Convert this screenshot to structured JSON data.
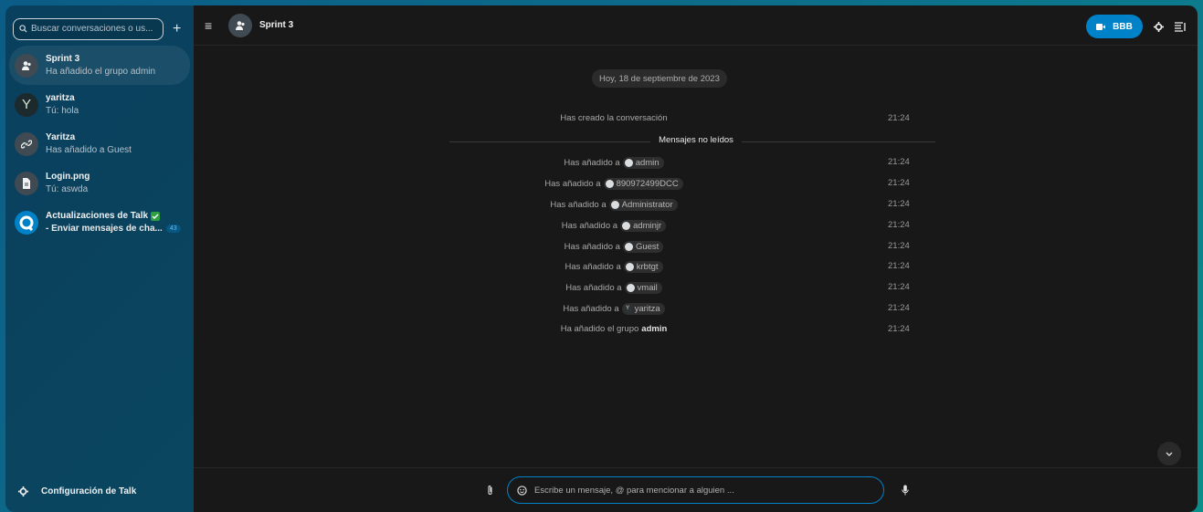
{
  "sidebar": {
    "search_placeholder": "Buscar conversaciones o us...",
    "plus": "+",
    "conversations": [
      {
        "name": "Sprint 3",
        "sub": "Ha añadido el grupo admin"
      },
      {
        "name": "yaritza",
        "sub": "Tú: hola",
        "avatar_letter": "Y"
      },
      {
        "name": "Yaritza",
        "sub": "Has añadido a Guest"
      },
      {
        "name": "Login.png",
        "sub": "Tú: aswda"
      },
      {
        "name": "Actualizaciones de Talk",
        "sub": "- Enviar mensajes de cha...",
        "badge": "43"
      }
    ],
    "settings_label": "Configuración de Talk"
  },
  "header": {
    "menu": "≡",
    "title": "Sprint 3",
    "call_label": "BBB"
  },
  "chat": {
    "date": "Hoy, 18 de septiembre de 2023",
    "created": {
      "text": "Has creado la conversación",
      "time": "21:24"
    },
    "unread_label": "Mensajes no leídos",
    "added_prefix": "Has añadido a",
    "added": [
      {
        "user": "admin",
        "time": "21:24"
      },
      {
        "user": "890972499DCC",
        "time": "21:24"
      },
      {
        "user": "Administrator",
        "time": "21:24"
      },
      {
        "user": "adminjr",
        "time": "21:24"
      },
      {
        "user": "Guest",
        "time": "21:24"
      },
      {
        "user": "krbtgt",
        "time": "21:24"
      },
      {
        "user": "vmail",
        "time": "21:24"
      },
      {
        "user": "yaritza",
        "time": "21:24",
        "avatar_letter": "Y"
      }
    ],
    "group": {
      "prefix": "Ha añadido el grupo",
      "name": "admin",
      "time": "21:24"
    }
  },
  "composer": {
    "placeholder": "Escribe un mensaje, @ para mencionar a alguien ..."
  },
  "colors": {
    "accent": "#0082c9",
    "main_bg": "#181818",
    "check": "#2ea043"
  },
  "icons": [
    "search-icon",
    "plus-icon",
    "group-icon",
    "link-icon",
    "file-icon",
    "talk-logo-icon",
    "check-icon",
    "gear-icon",
    "menu-icon",
    "video-icon",
    "sidebar-toggle-icon",
    "chevron-down-icon",
    "attachment-icon",
    "emoji-icon",
    "microphone-icon"
  ]
}
